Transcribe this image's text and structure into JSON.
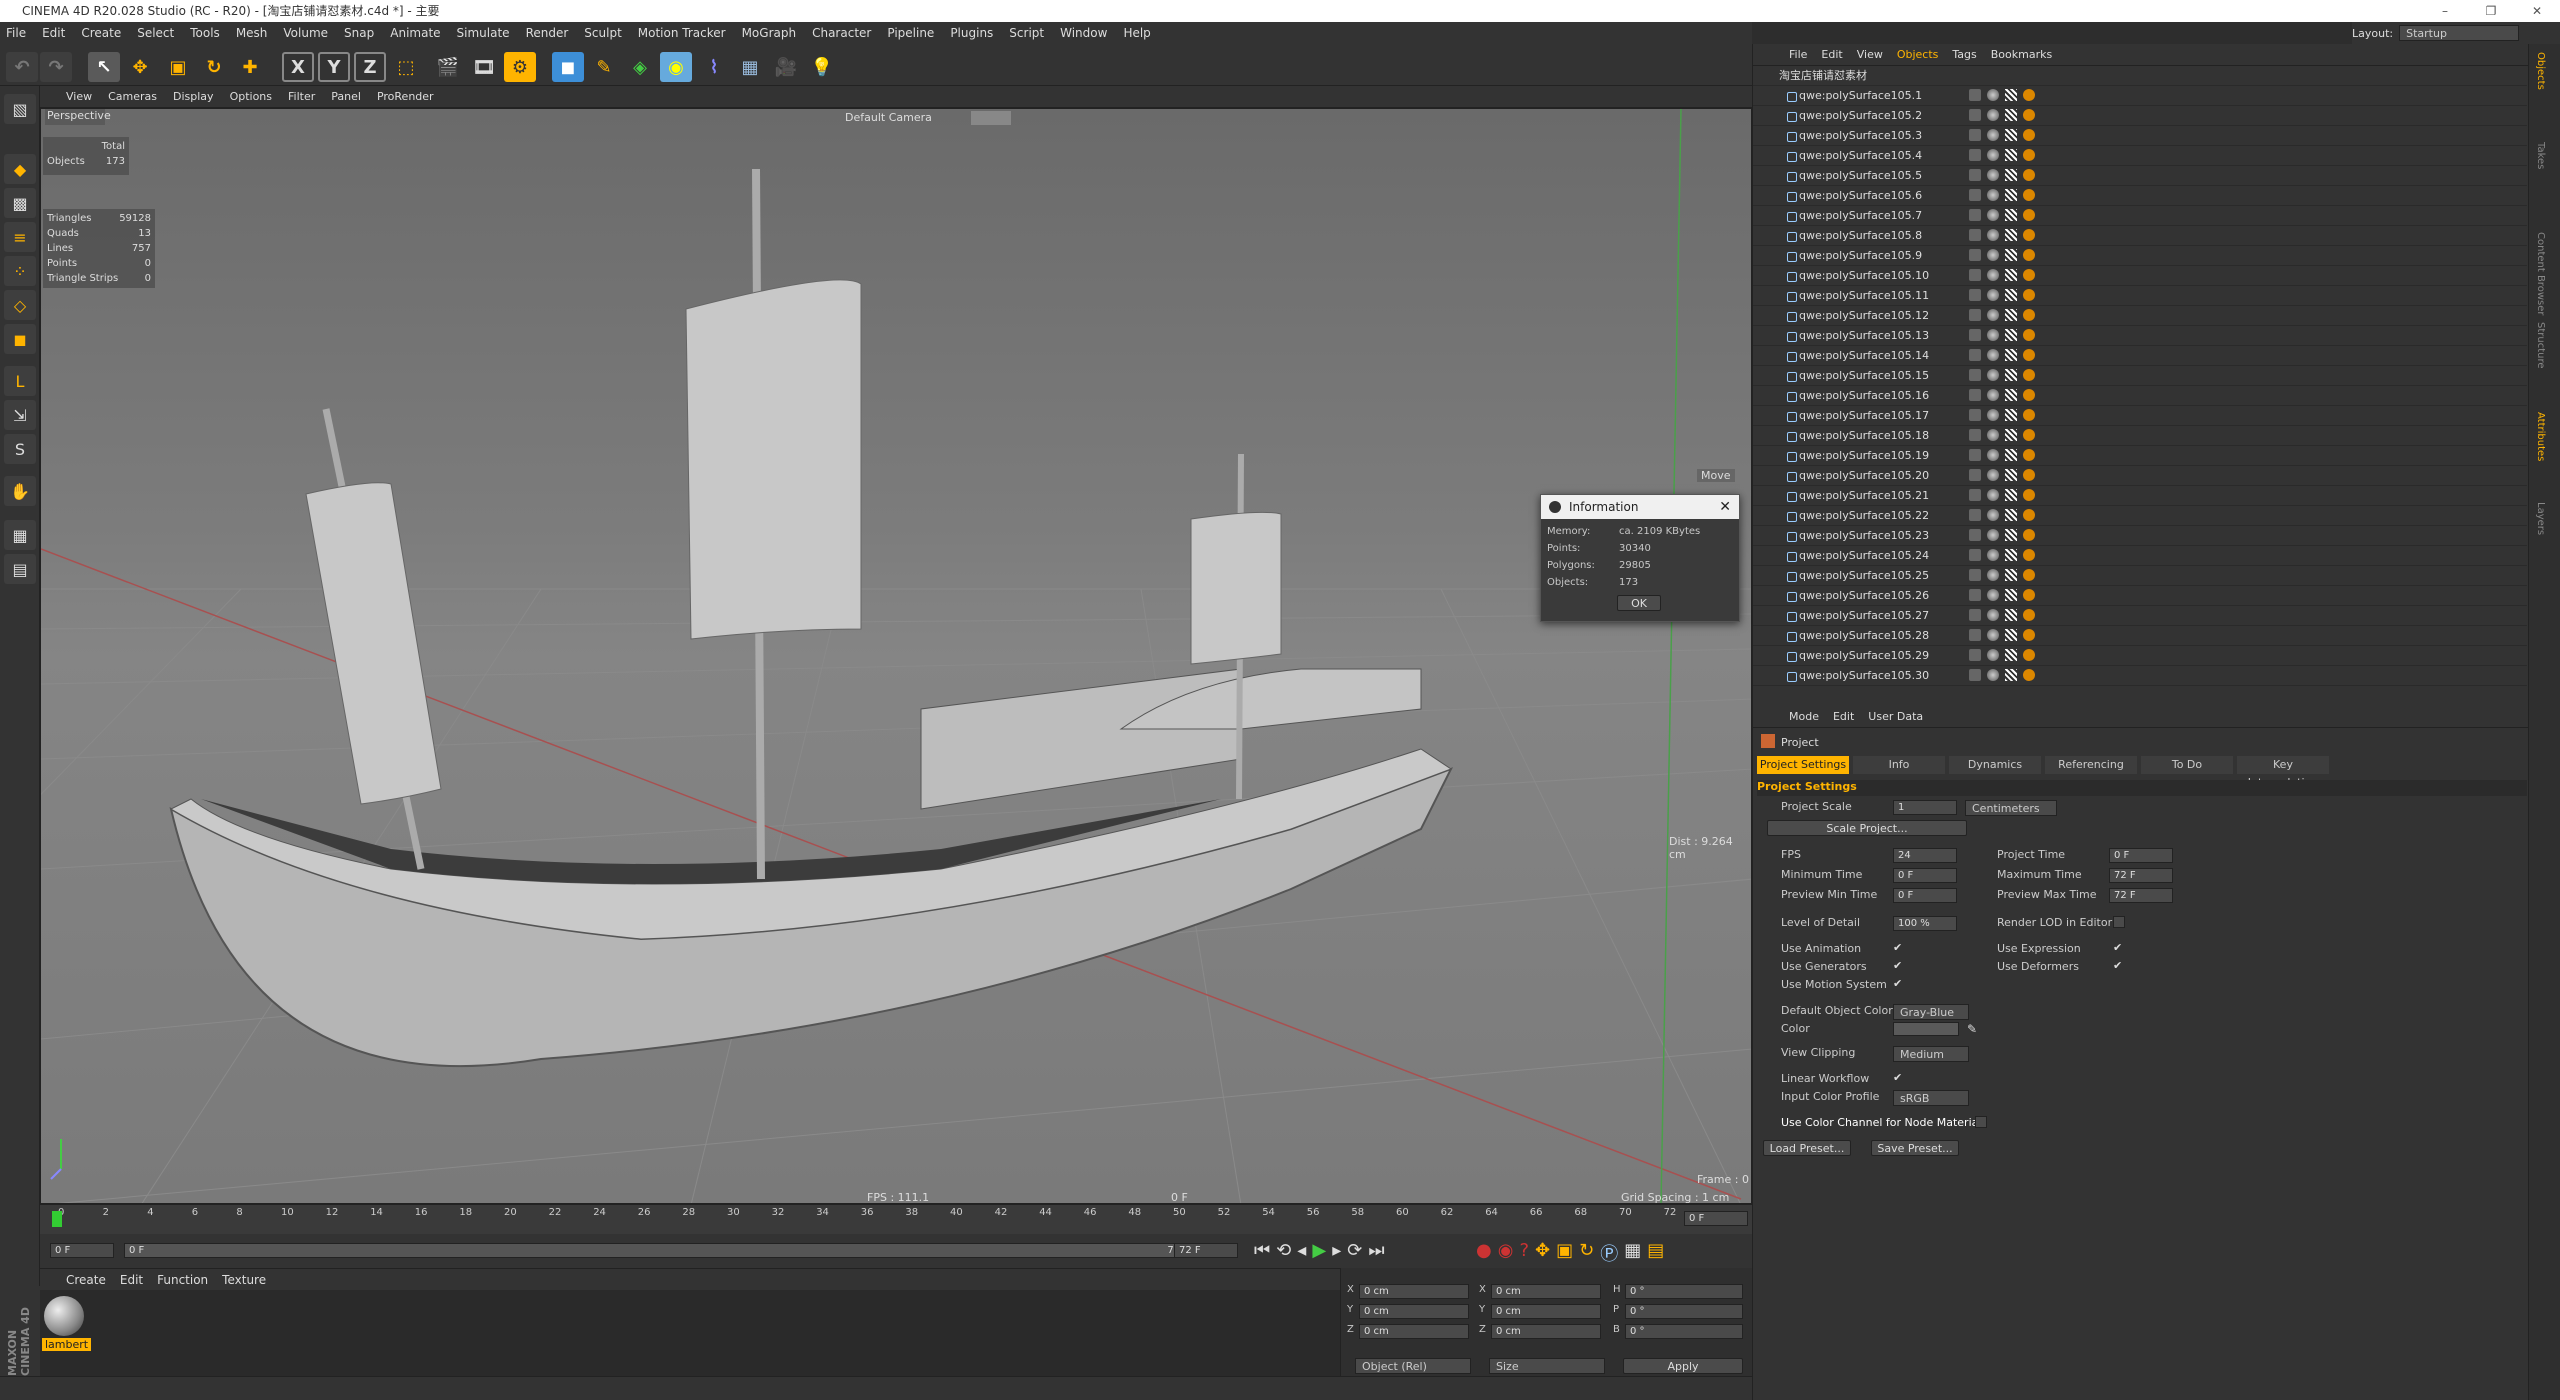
{
  "window": {
    "title": "CINEMA 4D R20.028 Studio (RC - R20) - [淘宝店铺请怼素材.c4d *] - 主要",
    "controls": [
      "–",
      "❐",
      "✕"
    ]
  },
  "menu": [
    "File",
    "Edit",
    "Create",
    "Select",
    "Tools",
    "Mesh",
    "Volume",
    "Snap",
    "Animate",
    "Simulate",
    "Render",
    "Sculpt",
    "Motion Tracker",
    "MoGraph",
    "Character",
    "Pipeline",
    "Plugins",
    "Script",
    "Window",
    "Help"
  ],
  "layout": {
    "label": "Layout:",
    "value": "Startup"
  },
  "viewport": {
    "menu": [
      "View",
      "Cameras",
      "Display",
      "Options",
      "Filter",
      "Panel",
      "ProRender"
    ],
    "name": "Perspective",
    "camera": "Default Camera",
    "stats": {
      "total_label": "Total",
      "objects_label": "Objects",
      "objects_value": "173",
      "rows": [
        {
          "label": "Triangles",
          "value": "59128"
        },
        {
          "label": "Quads",
          "value": "13"
        },
        {
          "label": "Lines",
          "value": "757"
        },
        {
          "label": "Points",
          "value": "0"
        },
        {
          "label": "Triangle Strips",
          "value": "0"
        }
      ]
    },
    "move_label": "Move",
    "dist_label": "Dist : 9.264 cm",
    "fps_label": "FPS : 111.1",
    "frame_center": "0 F",
    "frame_label": "Frame : 0",
    "grid_label": "Grid Spacing : 1 cm"
  },
  "info_dialog": {
    "title": "Information",
    "rows": [
      {
        "label": "Memory:",
        "value": "ca. 2109 KBytes"
      },
      {
        "label": "Points:",
        "value": "30340"
      },
      {
        "label": "Polygons:",
        "value": "29805"
      },
      {
        "label": "Objects:",
        "value": "173"
      }
    ],
    "ok_label": "OK"
  },
  "timeline": {
    "ticks": [
      "0",
      "2",
      "4",
      "6",
      "8",
      "10",
      "12",
      "14",
      "16",
      "18",
      "20",
      "22",
      "24",
      "26",
      "28",
      "30",
      "32",
      "34",
      "36",
      "38",
      "40",
      "42",
      "44",
      "46",
      "48",
      "50",
      "52",
      "54",
      "56",
      "58",
      "60",
      "62",
      "64",
      "66",
      "68",
      "70",
      "72"
    ],
    "current": "0 F",
    "start": "0 F",
    "range_start": "0 F",
    "range_end": "72 F",
    "end": "72 F"
  },
  "material_manager": {
    "menu": [
      "Create",
      "Edit",
      "Function",
      "Texture"
    ],
    "material_name": "lambert"
  },
  "coords": {
    "rows": [
      {
        "a": "X",
        "av": "0 cm",
        "b": "X",
        "bv": "0 cm",
        "c": "H",
        "cv": "0 °"
      },
      {
        "a": "Y",
        "av": "0 cm",
        "b": "Y",
        "bv": "0 cm",
        "c": "P",
        "cv": "0 °"
      },
      {
        "a": "Z",
        "av": "0 cm",
        "b": "Z",
        "bv": "0 cm",
        "c": "B",
        "cv": "0 °"
      }
    ],
    "mode": "Object (Rel)",
    "size": "Size",
    "apply": "Apply"
  },
  "object_manager": {
    "menu": [
      "File",
      "Edit",
      "View",
      "Objects",
      "Tags",
      "Bookmarks"
    ],
    "root": "淘宝店铺请怼素材",
    "objects": [
      "qwe:polySurface105.1",
      "qwe:polySurface105.2",
      "qwe:polySurface105.3",
      "qwe:polySurface105.4",
      "qwe:polySurface105.5",
      "qwe:polySurface105.6",
      "qwe:polySurface105.7",
      "qwe:polySurface105.8",
      "qwe:polySurface105.9",
      "qwe:polySurface105.10",
      "qwe:polySurface105.11",
      "qwe:polySurface105.12",
      "qwe:polySurface105.13",
      "qwe:polySurface105.14",
      "qwe:polySurface105.15",
      "qwe:polySurface105.16",
      "qwe:polySurface105.17",
      "qwe:polySurface105.18",
      "qwe:polySurface105.19",
      "qwe:polySurface105.20",
      "qwe:polySurface105.21",
      "qwe:polySurface105.22",
      "qwe:polySurface105.23",
      "qwe:polySurface105.24",
      "qwe:polySurface105.25",
      "qwe:polySurface105.26",
      "qwe:polySurface105.27",
      "qwe:polySurface105.28",
      "qwe:polySurface105.29",
      "qwe:polySurface105.30"
    ]
  },
  "attributes": {
    "menu": [
      "Mode",
      "Edit",
      "User Data"
    ],
    "title": "Project",
    "tabs": [
      "Project Settings",
      "Info",
      "Dynamics",
      "Referencing",
      "To Do",
      "Key Interpolation"
    ],
    "section": "Project Settings",
    "project_scale": {
      "label": "Project Scale",
      "value": "1",
      "unit": "Centimeters"
    },
    "scale_button": "Scale Project...",
    "fps": {
      "label": "FPS",
      "value": "24"
    },
    "project_time": {
      "label": "Project Time",
      "value": "0 F"
    },
    "min_time": {
      "label": "Minimum Time",
      "value": "0 F"
    },
    "max_time": {
      "label": "Maximum Time",
      "value": "72 F"
    },
    "preview_min": {
      "label": "Preview Min Time",
      "value": "0 F"
    },
    "preview_max": {
      "label": "Preview Max Time",
      "value": "72 F"
    },
    "lod": {
      "label": "Level of Detail",
      "value": "100 %"
    },
    "render_lod": {
      "label": "Render LOD in Editor"
    },
    "use_animation": "Use Animation",
    "use_expression": "Use Expression",
    "use_generators": "Use Generators",
    "use_deformers": "Use Deformers",
    "use_motion": "Use Motion System",
    "default_color": {
      "label": "Default Object Color",
      "value": "Gray-Blue"
    },
    "color_label": "Color",
    "view_clipping": {
      "label": "View Clipping",
      "value": "Medium"
    },
    "linear_workflow": "Linear Workflow",
    "input_profile": {
      "label": "Input Color Profile",
      "value": "sRGB"
    },
    "node_material": "Use Color Channel for Node Material",
    "load_preset": "Load Preset...",
    "save_preset": "Save Preset..."
  },
  "side_tabs": [
    "Objects",
    "Takes",
    "Content Browser",
    "Structure",
    "Attributes",
    "Layers"
  ],
  "colors": {
    "accent": "#ffb400",
    "active_tab": "#ffb400",
    "x_axis": "#d04040",
    "y_axis": "#40c040"
  }
}
